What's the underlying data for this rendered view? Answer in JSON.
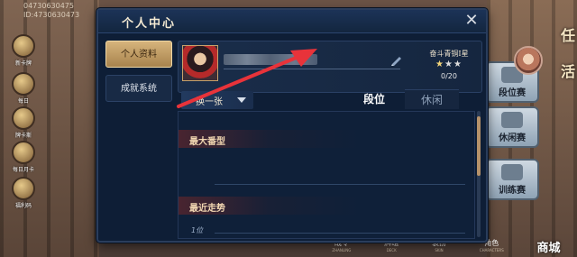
{
  "background": {
    "uid_text_1": "04730630475",
    "uid_text_2": "ID:4730630473",
    "left_icons": [
      {
        "label": "新卡牌",
        "icon": "card-pack-icon"
      },
      {
        "label": "每日",
        "icon": "gift-icon"
      },
      {
        "label": "牌卡斯",
        "icon": "chat-icon"
      },
      {
        "label": "每日月卡",
        "icon": "monthly-card-icon"
      },
      {
        "label": "福利码",
        "icon": "gift-code-icon"
      }
    ],
    "right_buttons": [
      {
        "label": "段位赛",
        "icon": "ranked-icon"
      },
      {
        "label": "休闲赛",
        "icon": "casual-icon"
      },
      {
        "label": "训练赛",
        "icon": "training-icon"
      }
    ],
    "corner_chars": [
      "任",
      "活"
    ],
    "bottom_nav": [
      {
        "cn": "战令",
        "en": "ZHANLING"
      },
      {
        "cn": "牌组",
        "en": "DECK"
      },
      {
        "cn": "装扮",
        "en": "SKIN"
      },
      {
        "cn": "角色",
        "en": "CHARACTERS"
      }
    ],
    "shop_label": "商城"
  },
  "dialog": {
    "title": "个人中心",
    "close_icon": "close-icon",
    "side_tabs": [
      {
        "label": "个人资料",
        "active": true
      },
      {
        "label": "成就系统",
        "active": false
      }
    ],
    "profile": {
      "rank_name": "奋斗青铜I星",
      "stars_filled": 1,
      "stars_total": 3,
      "progress": "0/20"
    },
    "filter_label": "换一张",
    "mode_tabs": [
      {
        "label": "段位",
        "active": true
      },
      {
        "label": "休闲",
        "active": false
      }
    ],
    "sections": {
      "max_fan": "最大番型",
      "recent_trend": "最近走势",
      "place_label": "1位"
    }
  },
  "colors": {
    "dialog_bg": "#0e1e36",
    "active_tab": "#d6b47c",
    "annotation_arrow": "#e8333a"
  }
}
